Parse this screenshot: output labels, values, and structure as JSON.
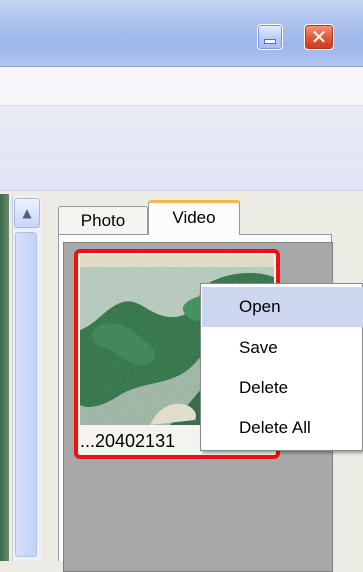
{
  "window": {
    "minimize_glyph": "_",
    "close_glyph": "✕"
  },
  "scrollbar": {
    "up_glyph": "▲"
  },
  "tabs": [
    {
      "label": "Photo",
      "selected": false
    },
    {
      "label": "Video",
      "selected": true
    }
  ],
  "thumbnail": {
    "caption": "...20402131",
    "selected": true,
    "highlight_color": "#ee1111"
  },
  "context_menu": {
    "items": [
      {
        "label": "Open",
        "highlighted": true
      },
      {
        "label": "Save",
        "highlighted": false
      },
      {
        "label": "Delete",
        "highlighted": false
      },
      {
        "label": "Delete All",
        "highlighted": false
      }
    ]
  },
  "colors": {
    "titlebar": "#a9c0ee",
    "tab_accent": "#f6b84c",
    "menu_highlight": "#cdd6ef"
  }
}
